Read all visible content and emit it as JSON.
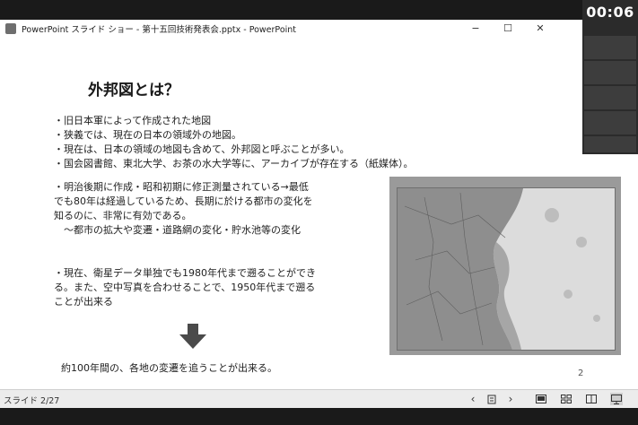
{
  "window": {
    "title": "PowerPoint スライド ショー  -  第十五回技術発表会.pptx - PowerPoint"
  },
  "slide": {
    "title": "外邦図とは？",
    "bullets_group1": [
      "・旧日本軍によって作成された地図",
      "・狭義では、現在の日本の領域外の地図。",
      "・現在は、日本の領域の地図も含めて、外邦図と呼ぶことが多い。",
      "・国会図書館、東北大学、お茶の水大学等に、アーカイブが存在する（紙媒体）。"
    ],
    "bullets_group2": [
      "・明治後期に作成・昭和初期に修正測量されている→最低",
      "でも80年は経過しているため、長期に於ける都市の変化を",
      "知るのに、非常に有効である。",
      "　～都市の拡大や変遷・道路網の変化・貯水池等の変化"
    ],
    "bullets_group3": [
      "・現在、衛星データ単独でも1980年代まで遡ることができ",
      "る。また、空中写真を合わせることで、1950年代まで遡る",
      "ことが出来る"
    ],
    "conclusion": "約100年間の、各地の変遷を追うことが出来る。",
    "page_number": "2"
  },
  "status": {
    "slide_counter": "スライド 2/27"
  },
  "meeting": {
    "timer": "00:06"
  },
  "colors": {
    "background": "#1a1a1a",
    "slide": "#ffffff",
    "statusbar": "#ececec",
    "video_tile": "#3d3d3d"
  }
}
